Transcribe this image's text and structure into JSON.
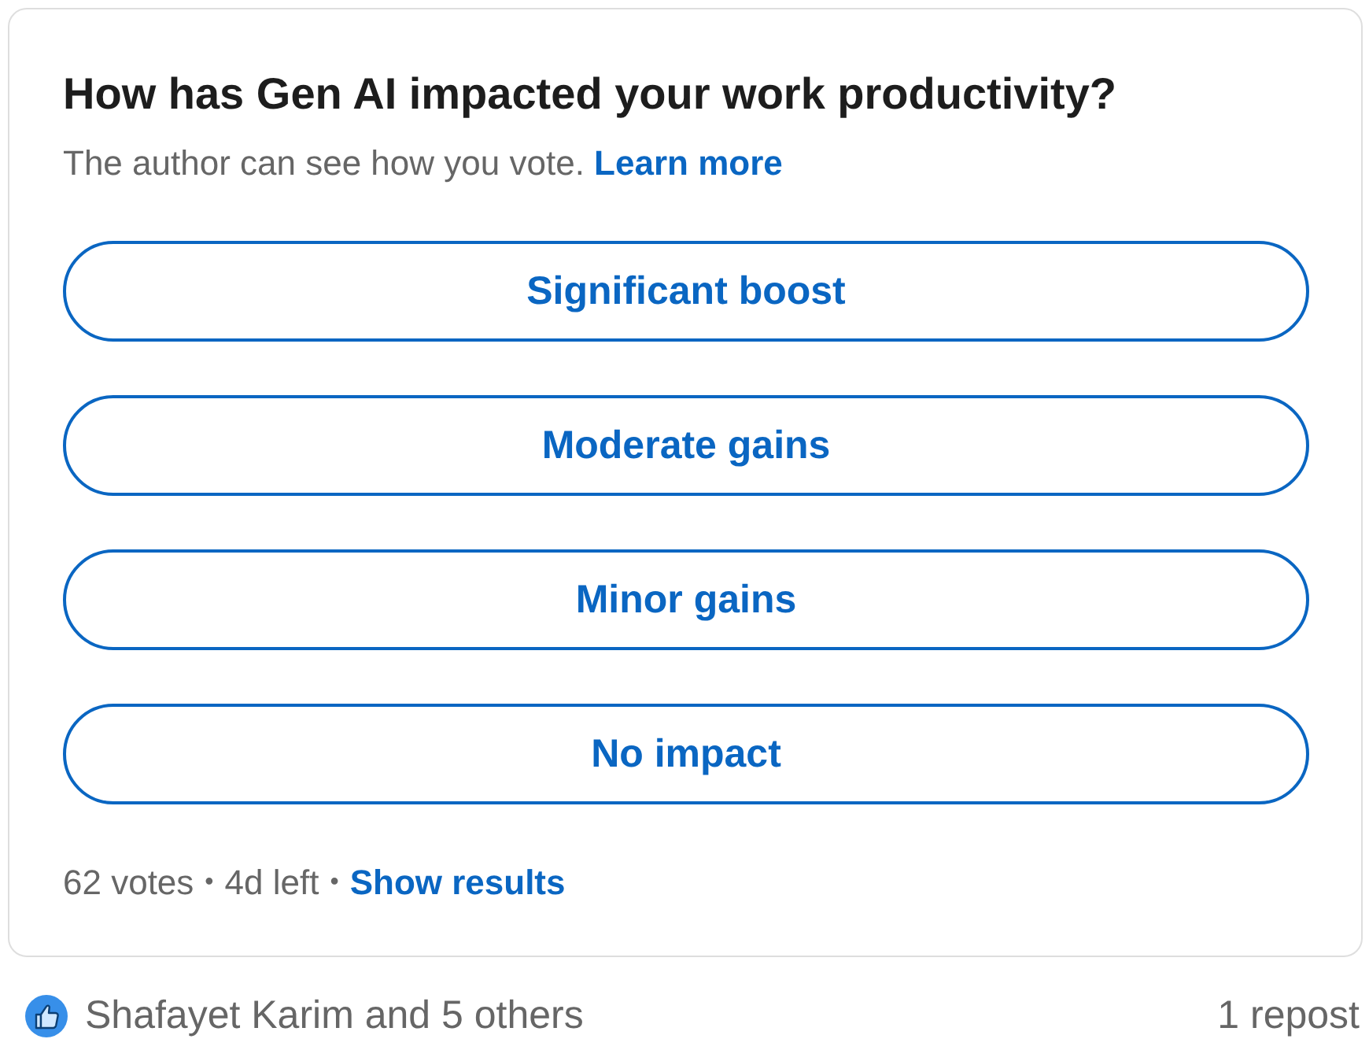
{
  "poll": {
    "question": "How has Gen AI impacted your work productivity?",
    "privacy_note": "The author can see how you vote.",
    "learn_more_link": "Learn more",
    "options": [
      {
        "label": "Significant boost"
      },
      {
        "label": "Moderate gains"
      },
      {
        "label": "Minor gains"
      },
      {
        "label": "No impact"
      }
    ],
    "footer": [
      {
        "kind": "text",
        "text": "62 votes"
      },
      {
        "kind": "separator",
        "text": "•"
      },
      {
        "kind": "text",
        "text": "4d left"
      },
      {
        "kind": "separator",
        "text": "•"
      },
      {
        "kind": "link",
        "text": "Show results"
      }
    ]
  },
  "social": {
    "reactions": "Shafayet Karim and 5 others",
    "reposts": "1 repost"
  }
}
